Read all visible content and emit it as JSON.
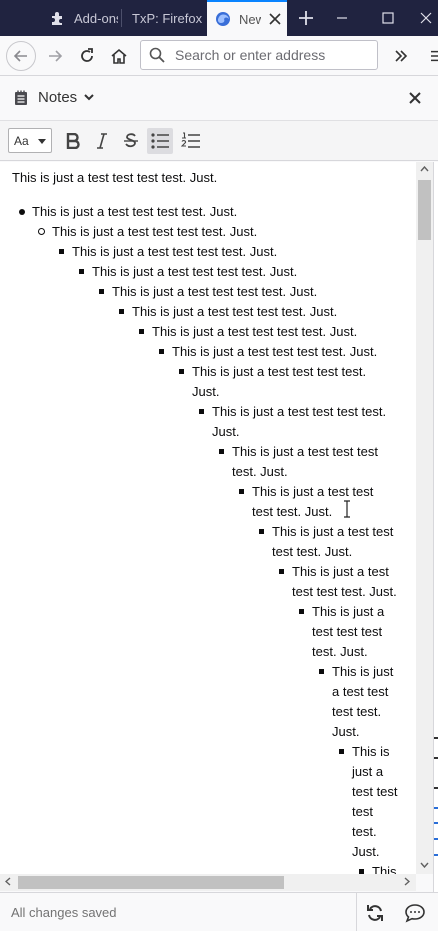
{
  "browser": {
    "tabs": [
      {
        "label": "Add-ons",
        "icon": "puzzle-icon"
      },
      {
        "label": "TxP: Firefox",
        "icon": ""
      },
      {
        "label": "New",
        "icon": "firefox-icon",
        "active": true
      }
    ],
    "url_placeholder": "Search or enter address"
  },
  "sidebar": {
    "title": "Notes"
  },
  "toolbar": {
    "font_select": "Aa"
  },
  "note": {
    "paragraph": "This is just a test test test test. Just.",
    "list_text": "This is just a test test test test. Just.",
    "wrapped": {
      "l8a": "This is just a test test test test.",
      "l8b": "Just.",
      "l9a": "This is just a test test test test.",
      "l9b": "Just.",
      "l10a": "This is just a test test test",
      "l10b": "test. Just.",
      "l11a": "This is just a test test",
      "l11b": "test test. Just.",
      "l12a": "This is just a test test",
      "l12b": "test test. Just.",
      "l13a": "This is just a test",
      "l13b": "test test test. Just.",
      "l14a": "This is just a",
      "l14b": "test test test",
      "l14c": "test. Just.",
      "l15a": "This is just",
      "l15b": "a test test",
      "l15c": "test test.",
      "l15d": "Just.",
      "l16a": "This is",
      "l16b": "just a",
      "l16c": "test test",
      "l16d": "test",
      "l16e": "test.",
      "l16f": "Just.",
      "l17a": "This"
    }
  },
  "footer": {
    "status": "All changes saved"
  },
  "colors": {
    "tabbar": "#202340",
    "accent": "#0a84ff"
  }
}
